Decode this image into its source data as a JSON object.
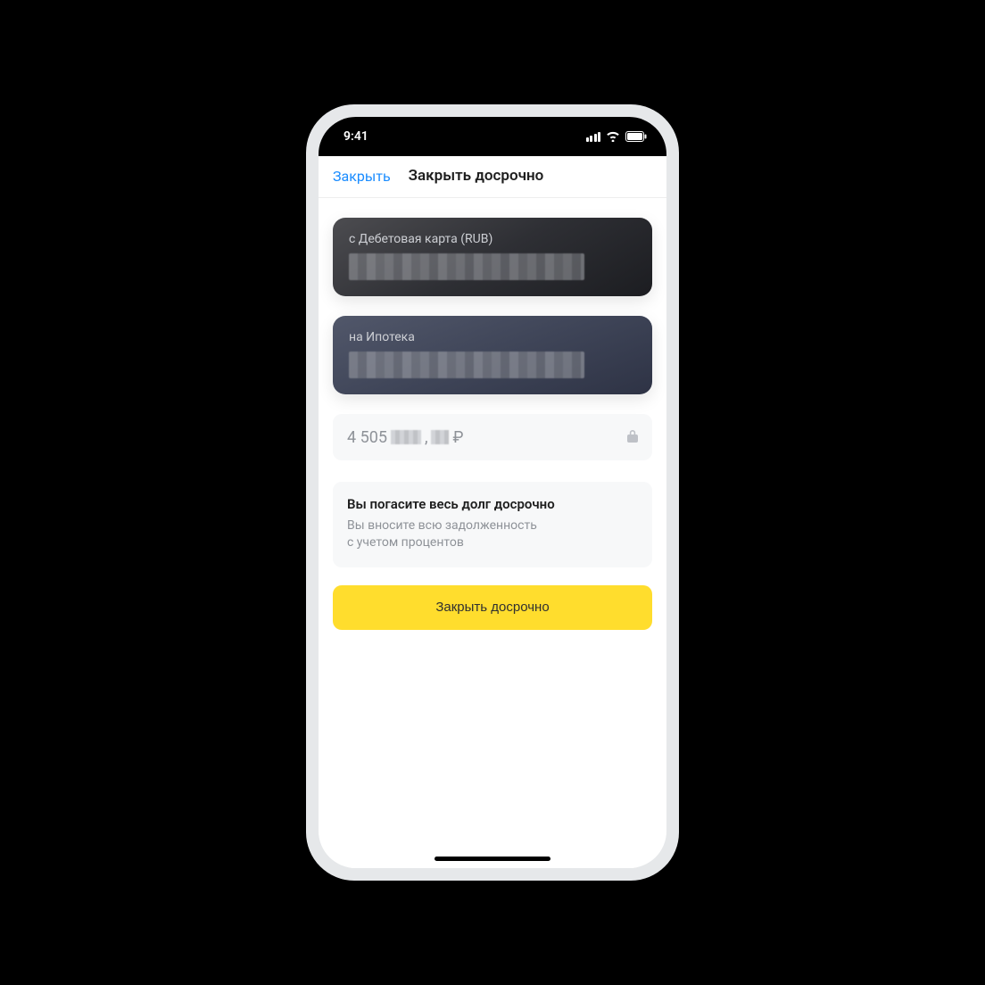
{
  "status": {
    "time": "9:41"
  },
  "nav": {
    "close": "Закрыть",
    "title": "Закрыть досрочно"
  },
  "from_card": {
    "label": "с Дебетовая карта (RUB)"
  },
  "to_card": {
    "label": "на Ипотека"
  },
  "amount": {
    "prefix": "4 505",
    "comma": ",",
    "currency": "₽"
  },
  "info": {
    "title": "Вы погасите весь долг досрочно",
    "body_line1": "Вы вносите всю задолженность",
    "body_line2": "с учетом процентов"
  },
  "cta": {
    "label": "Закрыть досрочно"
  },
  "colors": {
    "accent": "#FFDD2D",
    "link": "#1A8CFF"
  }
}
